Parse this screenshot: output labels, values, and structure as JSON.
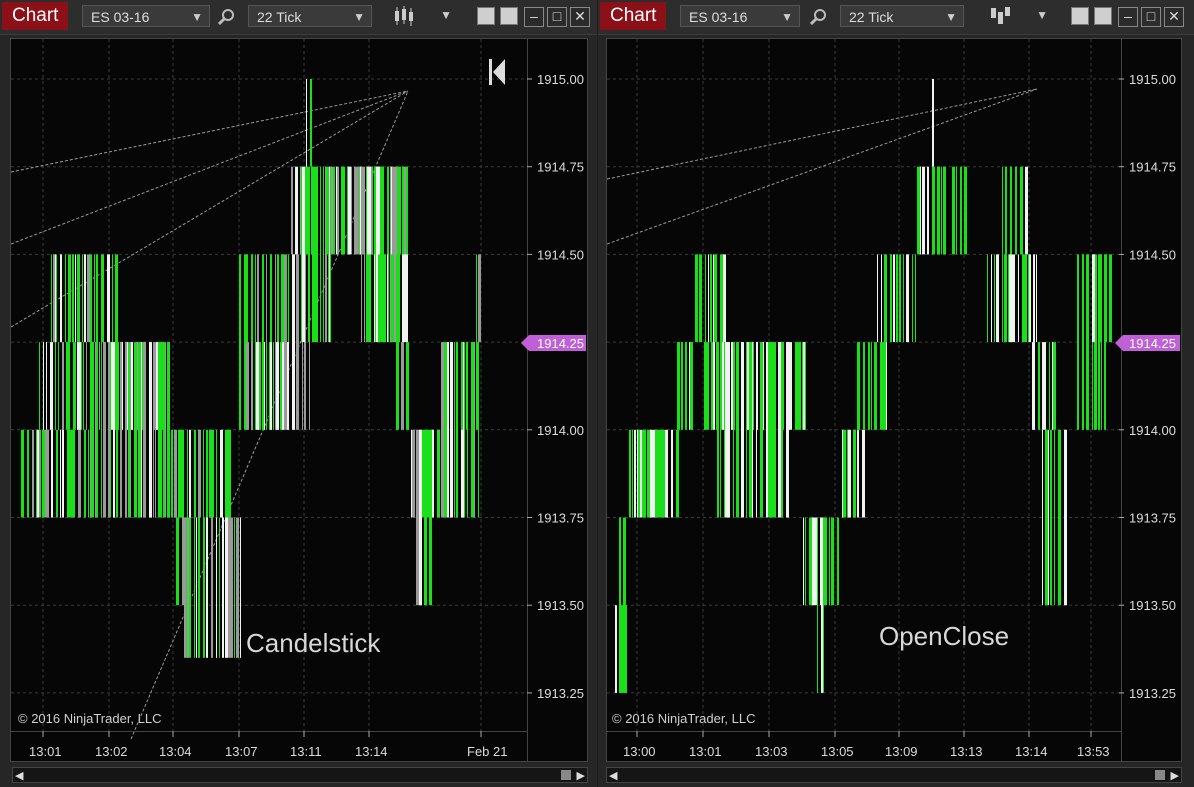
{
  "colors": {
    "chart_btn": "#8b1018",
    "bar_green": "#19e019",
    "bar_white": "#f2f2f2",
    "bar_gray": "#9a9a9a",
    "current_price_bg": "#c060d8"
  },
  "windows": [
    {
      "chart_button": "Chart",
      "instrument": "ES 03-16",
      "interval": "22 Tick",
      "chart_style_icon": "candlestick-icon",
      "overlay_label": "Candelstick",
      "copyright": "© 2016 NinjaTrader, LLC",
      "price_labels": [
        "1915.00",
        "1914.75",
        "1914.50",
        "1914.25",
        "1914.00",
        "1913.75",
        "1913.50",
        "1913.25"
      ],
      "current_price": "1914.25",
      "time_labels": [
        "13:01",
        "13:02",
        "13:04",
        "13:07",
        "13:11",
        "13:14",
        "Feb 21"
      ]
    },
    {
      "chart_button": "Chart",
      "instrument": "ES 03-16",
      "interval": "22 Tick",
      "chart_style_icon": "open-close-icon",
      "overlay_label": "OpenClose",
      "copyright": "© 2016 NinjaTrader, LLC",
      "price_labels": [
        "1915.00",
        "1914.75",
        "1914.50",
        "1914.25",
        "1914.00",
        "1913.75",
        "1913.50",
        "1913.25"
      ],
      "current_price": "1914.25",
      "time_labels": [
        "13:00",
        "13:01",
        "13:03",
        "13:05",
        "13:09",
        "13:13",
        "13:14",
        "13:53"
      ]
    }
  ]
}
